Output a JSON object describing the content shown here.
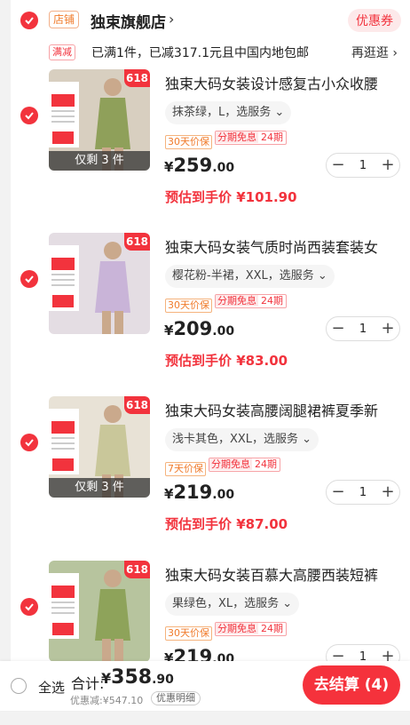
{
  "shop": {
    "tag": "店铺",
    "name": "独束旗舰店",
    "arrow": "›",
    "coupon_label": "优惠券"
  },
  "promo": {
    "tag": "满减",
    "text": "已满1件，已减317.1元且中国内地包邮",
    "link": "再逛逛 ›"
  },
  "items": [
    {
      "title": "独束大码女装设计感复古小众收腰",
      "spec": "抹茶绿，L，选服务 ⌄",
      "tag1": "30天价保",
      "tag2_left": "分期免息",
      "tag2_right": "24期",
      "price_cur": "¥",
      "price_int": "259",
      "price_dec": ".00",
      "qty": "1",
      "est": "预估到手价 ¥101.90",
      "badge": "618",
      "stock": "仅剩 3 件",
      "img_colors": {
        "bg": "#d8cfc0",
        "cloth": "#8fa05a"
      }
    },
    {
      "title": "独束大码女装气质时尚西装套装女",
      "spec": "樱花粉-半裙，XXL，选服务 ⌄",
      "tag1": "30天价保",
      "tag2_left": "分期免息",
      "tag2_right": "24期",
      "price_cur": "¥",
      "price_int": "209",
      "price_dec": ".00",
      "qty": "1",
      "est": "预估到手价 ¥83.00",
      "badge": "618",
      "stock": "",
      "img_colors": {
        "bg": "#e4dde3",
        "cloth": "#c9b4d8"
      }
    },
    {
      "title": "独束大码女装高腰阔腿裙裤夏季新",
      "spec": "浅卡其色，XXL，选服务 ⌄",
      "tag1": "7天价保",
      "tag2_left": "分期免息",
      "tag2_right": "24期",
      "price_cur": "¥",
      "price_int": "219",
      "price_dec": ".00",
      "qty": "1",
      "est": "预估到手价 ¥87.00",
      "badge": "618",
      "stock": "仅剩 3 件",
      "img_colors": {
        "bg": "#e8e2d6",
        "cloth": "#c9c79a"
      }
    },
    {
      "title": "独束大码女装百慕大高腰西装短裤",
      "spec": "果绿色，XL，选服务 ⌄",
      "tag1": "30天价保",
      "tag2_left": "分期免息",
      "tag2_right": "24期",
      "price_cur": "¥",
      "price_int": "219",
      "price_dec": ".00",
      "qty": "1",
      "est": "",
      "badge": "618",
      "stock": "",
      "img_colors": {
        "bg": "#b7c49e",
        "cloth": "#8ea35a"
      }
    }
  ],
  "bottom": {
    "select_all": "全选",
    "total_label": "合计:",
    "total_cur": "¥",
    "total_int": "358",
    "total_dec": ".90",
    "discount": "优惠减:¥547.10",
    "discount_link": "优惠明细",
    "checkout": "去结算 (4)"
  },
  "colors": {
    "accent": "#f2333d",
    "orange": "#f07a2a"
  }
}
